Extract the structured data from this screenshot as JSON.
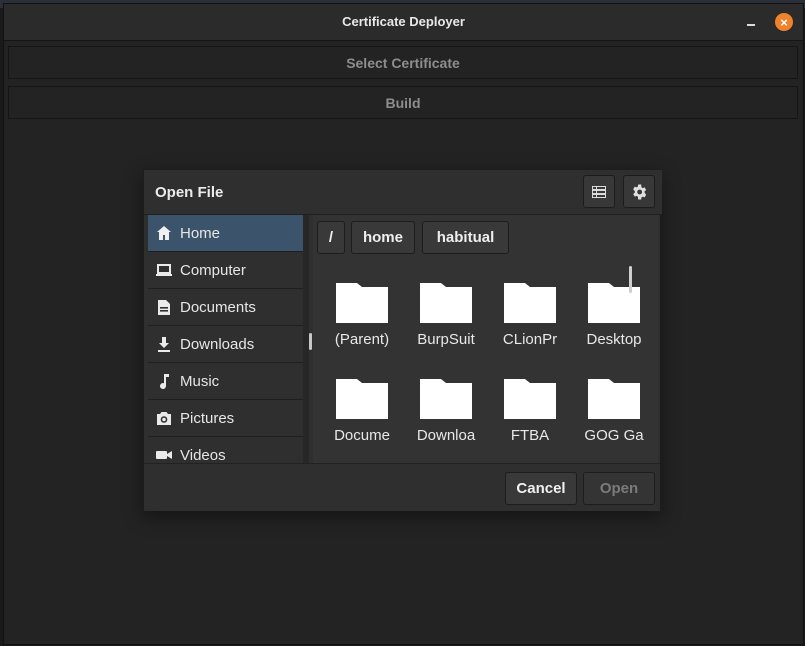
{
  "window": {
    "title": "Certificate Deployer",
    "close_glyph": "×",
    "buttons": {
      "select_certificate": "Select Certificate",
      "build": "Build"
    }
  },
  "dialog": {
    "title": "Open File",
    "header_icons": [
      "list-icon",
      "gear-icon"
    ],
    "sidebar": {
      "items": [
        {
          "label": "Home",
          "icon": "home-icon",
          "active": true
        },
        {
          "label": "Computer",
          "icon": "computer-icon",
          "active": false
        },
        {
          "label": "Documents",
          "icon": "document-icon",
          "active": false
        },
        {
          "label": "Downloads",
          "icon": "download-icon",
          "active": false
        },
        {
          "label": "Music",
          "icon": "music-icon",
          "active": false
        },
        {
          "label": "Pictures",
          "icon": "camera-icon",
          "active": false
        },
        {
          "label": "Videos",
          "icon": "video-icon",
          "active": false
        }
      ]
    },
    "breadcrumbs": [
      "/",
      "home",
      "habitual"
    ],
    "files": [
      {
        "label": "(Parent)",
        "icon": "folder-icon"
      },
      {
        "label": "BurpSuit",
        "icon": "folder-icon"
      },
      {
        "label": "CLionPr",
        "icon": "folder-icon"
      },
      {
        "label": "Desktop",
        "icon": "folder-icon"
      },
      {
        "label": "Docume",
        "icon": "folder-icon"
      },
      {
        "label": "Downloa",
        "icon": "folder-icon"
      },
      {
        "label": "FTBA",
        "icon": "folder-icon"
      },
      {
        "label": "GOG Ga",
        "icon": "folder-icon"
      }
    ],
    "buttons": {
      "cancel": "Cancel",
      "open": "Open"
    }
  },
  "colors": {
    "accent_close": "#f0822b",
    "selection": "#3b536b",
    "background": "#232323",
    "dialog": "#2f2f2f"
  }
}
